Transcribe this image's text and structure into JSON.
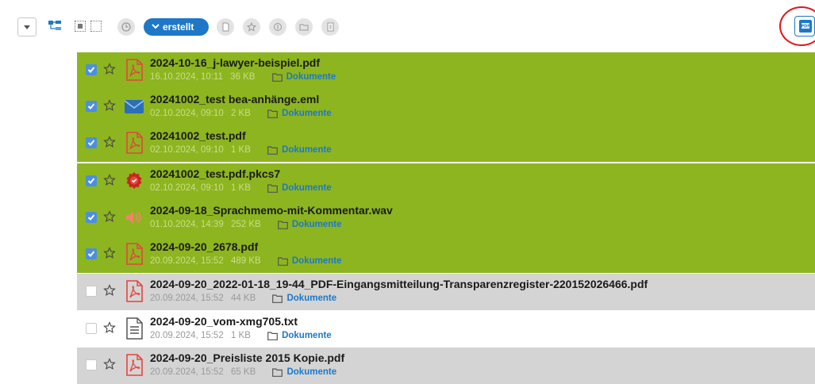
{
  "toolbar": {
    "sort_filter_label": "erstellt",
    "accent_color": "#1e78c7",
    "selected_row_color": "#8db51f",
    "icons": [
      "dropdown-icon",
      "tree-view-icon",
      "select-some-icon",
      "select-none-icon",
      "clock-icon",
      "document-icon",
      "star-icon",
      "tag-icon",
      "folder-icon",
      "file-icon",
      "pdf-export-icon"
    ]
  },
  "files": [
    {
      "name": "2024-10-16_j-lawyer-beispiel.pdf",
      "date": "16.10.2024, 10:11",
      "size": "36 KB",
      "folder": "Dokumente",
      "checked": true,
      "icon": "pdf-icon"
    },
    {
      "name": "20241002_test bea-anhänge.eml",
      "date": "02.10.2024, 09:10",
      "size": "2 KB",
      "folder": "Dokumente",
      "checked": true,
      "icon": "email-icon"
    },
    {
      "name": "20241002_test.pdf",
      "date": "02.10.2024, 09:10",
      "size": "1 KB",
      "folder": "Dokumente",
      "checked": true,
      "icon": "pdf-icon"
    },
    {
      "name": "20241002_test.pdf.pkcs7",
      "date": "02.10.2024, 09:10",
      "size": "1 KB",
      "folder": "Dokumente",
      "checked": true,
      "icon": "signature-seal-icon"
    },
    {
      "name": "2024-09-18_Sprachmemo-mit-Kommentar.wav",
      "date": "01.10.2024, 14:39",
      "size": "252 KB",
      "folder": "Dokumente",
      "checked": true,
      "icon": "audio-icon"
    },
    {
      "name": "2024-09-20_2678.pdf",
      "date": "20.09.2024, 15:52",
      "size": "489 KB",
      "folder": "Dokumente",
      "checked": true,
      "icon": "pdf-icon"
    },
    {
      "name": "2024-09-20_2022-01-18_19-44_PDF-Eingangsmitteilung-Transparenzregister-220152026466.pdf",
      "date": "20.09.2024, 15:52",
      "size": "44 KB",
      "folder": "Dokumente",
      "checked": false,
      "icon": "pdf-icon"
    },
    {
      "name": "2024-09-20_vom-xmg705.txt",
      "date": "20.09.2024, 15:52",
      "size": "1 KB",
      "folder": "Dokumente",
      "checked": false,
      "icon": "text-file-icon"
    },
    {
      "name": "2024-09-20_Preisliste 2015 Kopie.pdf",
      "date": "20.09.2024, 15:52",
      "size": "65 KB",
      "folder": "Dokumente",
      "checked": false,
      "icon": "pdf-icon"
    }
  ]
}
